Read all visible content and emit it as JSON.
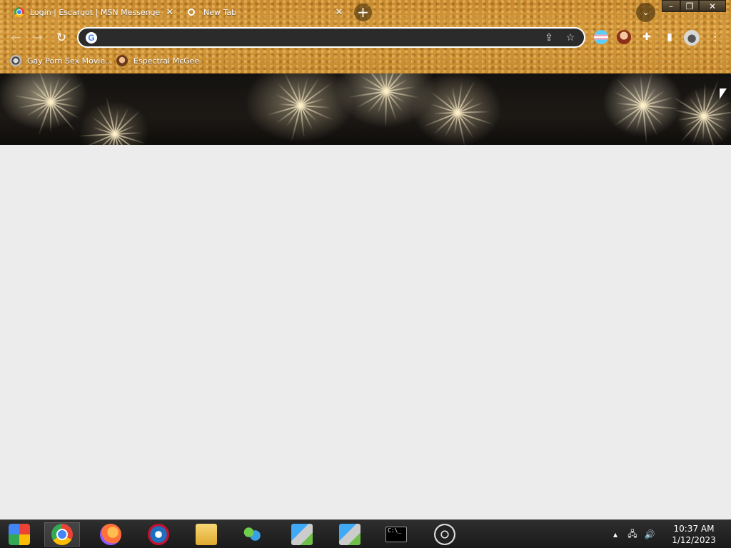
{
  "browser": {
    "tabs": [
      {
        "title": "Login | Escargot | MSN Messenger",
        "active": true
      },
      {
        "title": "New Tab",
        "active": false
      }
    ],
    "omnibox": {
      "value": "",
      "placeholder": ""
    },
    "bookmarks": [
      {
        "label": "Gay Porn Sex Movie..."
      },
      {
        "label": "Espectral McGee"
      }
    ],
    "theme_colors": {
      "frame": "#c98a2e",
      "omnibox": "#2b2b2b"
    }
  },
  "page": {
    "banner": "fireworks",
    "background": "#ececec"
  },
  "taskbar": {
    "pinned": [
      "chrome-logo-start-icon",
      "google-chrome-icon",
      "firefox-icon",
      "opera-icon",
      "file-explorer-icon",
      "windows-messenger-icon",
      "setup-installer-icon",
      "setup-installer-icon",
      "command-prompt-icon",
      "disc-drive-icon"
    ],
    "cmd_prompt_text": "C:\\_",
    "clock": {
      "time": "10:37 AM",
      "date": "1/12/2023"
    }
  }
}
